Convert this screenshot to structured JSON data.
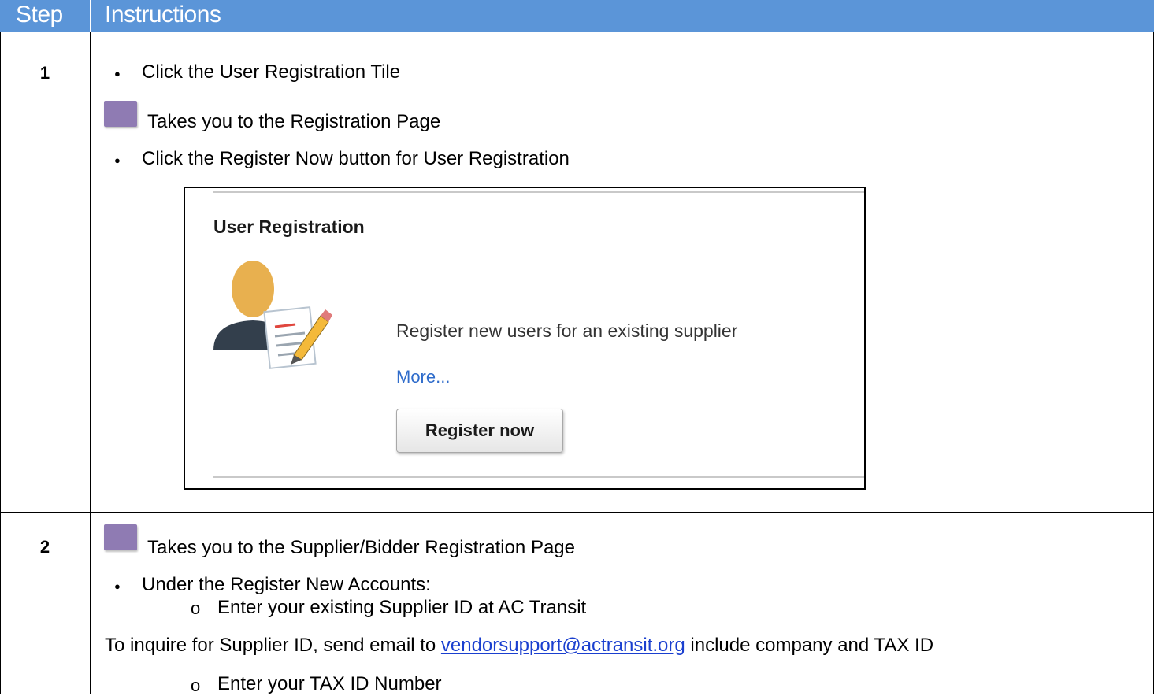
{
  "table": {
    "headers": {
      "step": "Step",
      "instructions": "Instructions"
    }
  },
  "step1": {
    "number": "1",
    "bullet1": "Click the User Registration Tile",
    "note1": "Takes you to the Registration Page",
    "bullet2": "Click the Register Now button for User Registration",
    "screenshot": {
      "title": "User Registration",
      "description": "Register new users for an existing supplier",
      "more_link": "More...",
      "button": "Register now"
    }
  },
  "step2": {
    "number": "2",
    "note1": "Takes you to the Supplier/Bidder Registration Page",
    "bullet1": "Under the Register New Accounts:",
    "sub1": "Enter your existing Supplier ID at AC Transit",
    "inquire_before": "To inquire for Supplier ID, send email to",
    "inquire_email": "vendorsupport@actransit.org",
    "inquire_after": "include company and TAX ID",
    "sub2": "Enter your TAX ID Number"
  },
  "colors": {
    "header_bg": "#5b95d8",
    "note_icon": "#8f7bb3",
    "link": "#1a3fcf"
  }
}
